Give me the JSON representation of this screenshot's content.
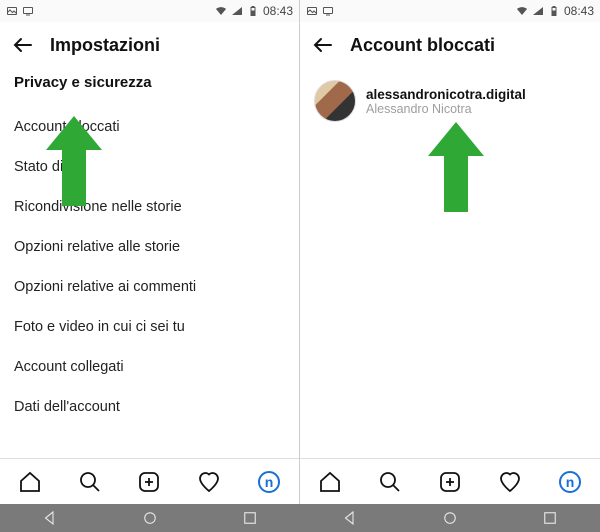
{
  "statusbar": {
    "time": "08:43"
  },
  "left_screen": {
    "title": "Impostazioni",
    "section": "Privacy e sicurezza",
    "items": [
      "Account bloccati",
      "Stato di a",
      "Ricondivisione nelle storie",
      "Opzioni relative alle storie",
      "Opzioni relative ai commenti",
      "Foto e video in cui ci sei tu",
      "Account collegati",
      "Dati dell'account"
    ]
  },
  "right_screen": {
    "title": "Account bloccati",
    "accounts": [
      {
        "username": "alessandronicotra.digital",
        "display": "Alessandro Nicotra"
      }
    ],
    "profile_letter": "n"
  },
  "colors": {
    "arrow": "#2fa836",
    "accent": "#1a6fd6"
  }
}
